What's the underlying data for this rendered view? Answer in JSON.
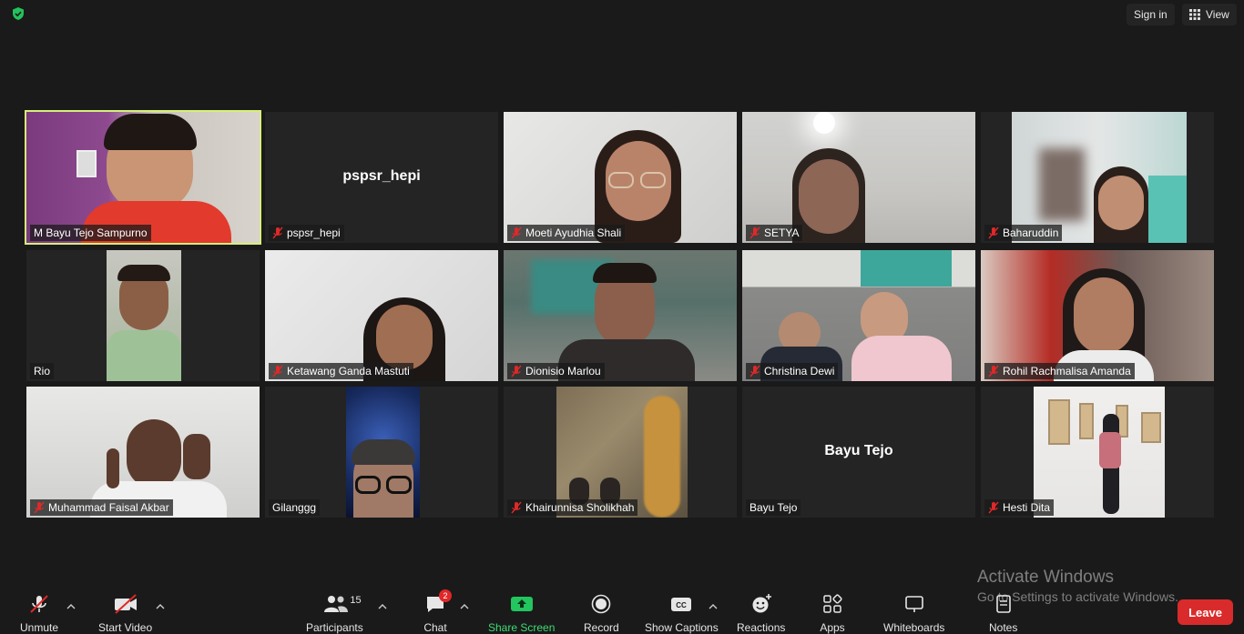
{
  "top": {
    "sign_in": "Sign in",
    "view": "View"
  },
  "tiles": [
    {
      "name": "M Bayu Tejo Sampurno",
      "muted": false,
      "active": true
    },
    {
      "name": "pspsr_hepi",
      "center_name": "pspsr_hepi",
      "muted": true
    },
    {
      "name": "Moeti Ayudhia Shali",
      "muted": true
    },
    {
      "name": "SETYA",
      "muted": true
    },
    {
      "name": "Baharuddin",
      "muted": true
    },
    {
      "name": "Rio",
      "muted": false
    },
    {
      "name": "Ketawang Ganda Mastuti",
      "muted": true
    },
    {
      "name": "Dionisio Marlou",
      "muted": true
    },
    {
      "name": "Christina Dewi",
      "muted": true
    },
    {
      "name": "Rohil Rachmalisa Amanda",
      "muted": true
    },
    {
      "name": "Muhammad Faisal Akbar",
      "muted": true
    },
    {
      "name": "Gilanggg",
      "muted": false
    },
    {
      "name": "Khairunnisa Sholikhah",
      "muted": true
    },
    {
      "name": "Bayu Tejo",
      "center_name": "Bayu Tejo",
      "muted": false
    },
    {
      "name": "Hesti Dita",
      "muted": true
    }
  ],
  "toolbar": {
    "unmute": "Unmute",
    "start_video": "Start Video",
    "participants": "Participants",
    "participants_count": "15",
    "chat": "Chat",
    "chat_badge": "2",
    "share_screen": "Share Screen",
    "record": "Record",
    "show_captions": "Show Captions",
    "reactions": "Reactions",
    "apps": "Apps",
    "whiteboards": "Whiteboards",
    "notes": "Notes",
    "leave": "Leave"
  },
  "watermark": {
    "title": "Activate Windows",
    "subtitle": "Go to Settings to activate Windows."
  },
  "colors": {
    "active_border": "#d6ef7a",
    "leave": "#d92b2b",
    "share_green": "#22c55e",
    "muted_red": "#e02828"
  }
}
